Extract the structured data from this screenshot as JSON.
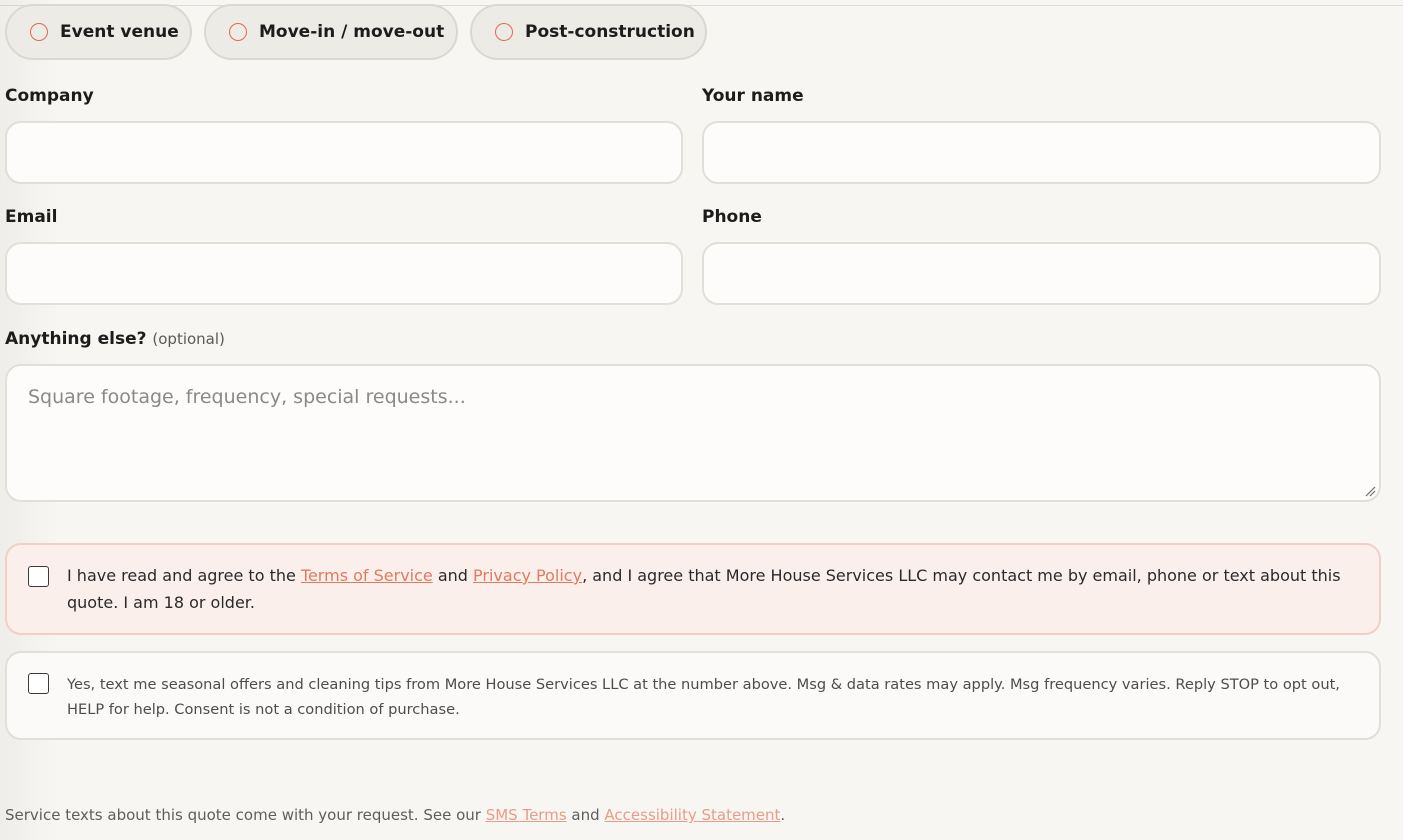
{
  "service_types": [
    {
      "label": "Event venue"
    },
    {
      "label": "Move-in / move-out"
    },
    {
      "label": "Post-construction"
    }
  ],
  "fields": {
    "company": {
      "label": "Company",
      "value": ""
    },
    "name": {
      "label": "Your name",
      "value": ""
    },
    "email": {
      "label": "Email",
      "value": ""
    },
    "phone": {
      "label": "Phone",
      "value": ""
    }
  },
  "notes": {
    "label": "Anything else?",
    "optional": "(optional)",
    "placeholder": "Square footage, frequency, special requests..."
  },
  "consent_terms": {
    "checked": false,
    "prefix": "I have read and agree to the ",
    "terms_link": "Terms of Service",
    "and": " and ",
    "privacy_link": "Privacy Policy",
    "suffix": ", and I agree that More House Services LLC may contact me by email, phone or text about this quote. I am 18 or older."
  },
  "consent_sms": {
    "checked": false,
    "text": "Yes, text me seasonal offers and cleaning tips from More House Services LLC at the number above. Msg & data rates may apply. Msg frequency varies. Reply STOP to opt out, HELP for help. Consent is not a condition of purchase."
  },
  "footer": {
    "prefix": "Service texts about this quote come with your request. See our ",
    "sms_link": "SMS Terms",
    "and": " and ",
    "accessibility_link": "Accessibility Statement",
    "suffix": "."
  },
  "colors": {
    "accent": "#e0694f",
    "link": "#e27a5f",
    "page_bg": "#f8f6f2",
    "warning_bg": "#fbefeb"
  }
}
